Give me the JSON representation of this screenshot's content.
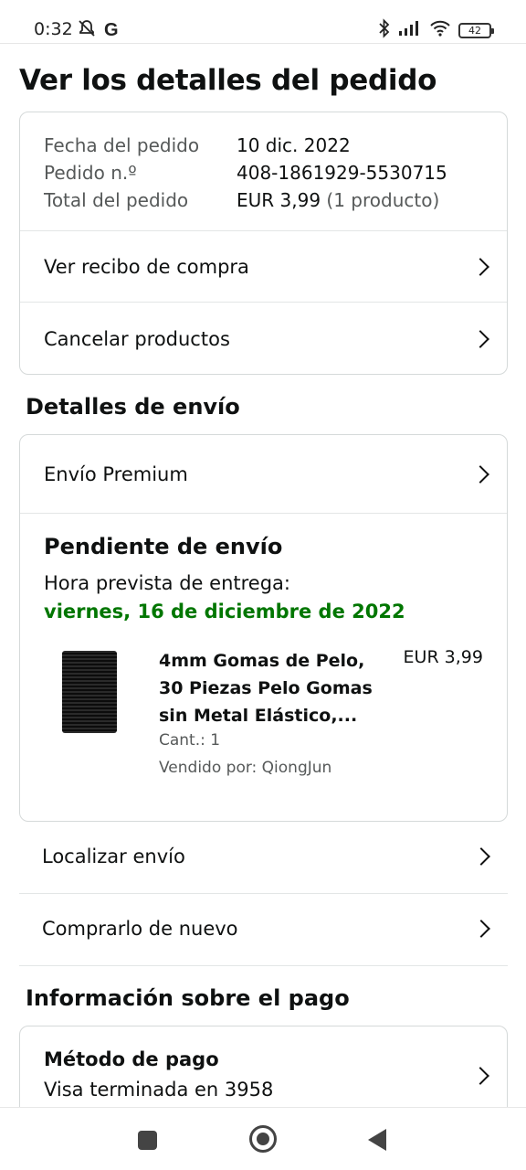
{
  "status_bar": {
    "time": "0:32",
    "battery": "42",
    "left_icons": [
      "mute-icon",
      "google-icon"
    ],
    "right_icons": [
      "bluetooth-icon",
      "signal-icon",
      "wifi-icon",
      "battery-icon"
    ]
  },
  "page_title": "Ver los detalles del pedido",
  "summary": {
    "date_label": "Fecha del pedido",
    "date_value": "10 dic. 2022",
    "order_label": "Pedido n.º",
    "order_value": "408-1861929-5530715",
    "total_label": "Total del pedido",
    "total_value": "EUR 3,99",
    "total_extra": "(1 producto)",
    "links": [
      "Ver recibo de compra",
      "Cancelar productos"
    ]
  },
  "shipping": {
    "section_title": "Detalles de envío",
    "method": "Envío Premium",
    "status": "Pendiente de envío",
    "eta_label": "Hora prevista de entrega:",
    "eta_date": "viernes, 16 de diciembre de 2022",
    "product": {
      "title": "4mm Gomas de Pelo, 30 Piezas Pelo Gomas sin Metal Elástico,...",
      "price": "EUR 3,99",
      "qty": "Cant.: 1",
      "seller": "Vendido por: QiongJun"
    },
    "actions": [
      "Localizar envío",
      "Comprarlo de nuevo"
    ]
  },
  "payment": {
    "section_title": "Información sobre el pago",
    "method_title": "Método de pago",
    "method_value": "Visa terminada en 3958"
  },
  "colors": {
    "eta_green": "#007600",
    "border": "#d5d9d9",
    "muted_text": "#565959"
  }
}
